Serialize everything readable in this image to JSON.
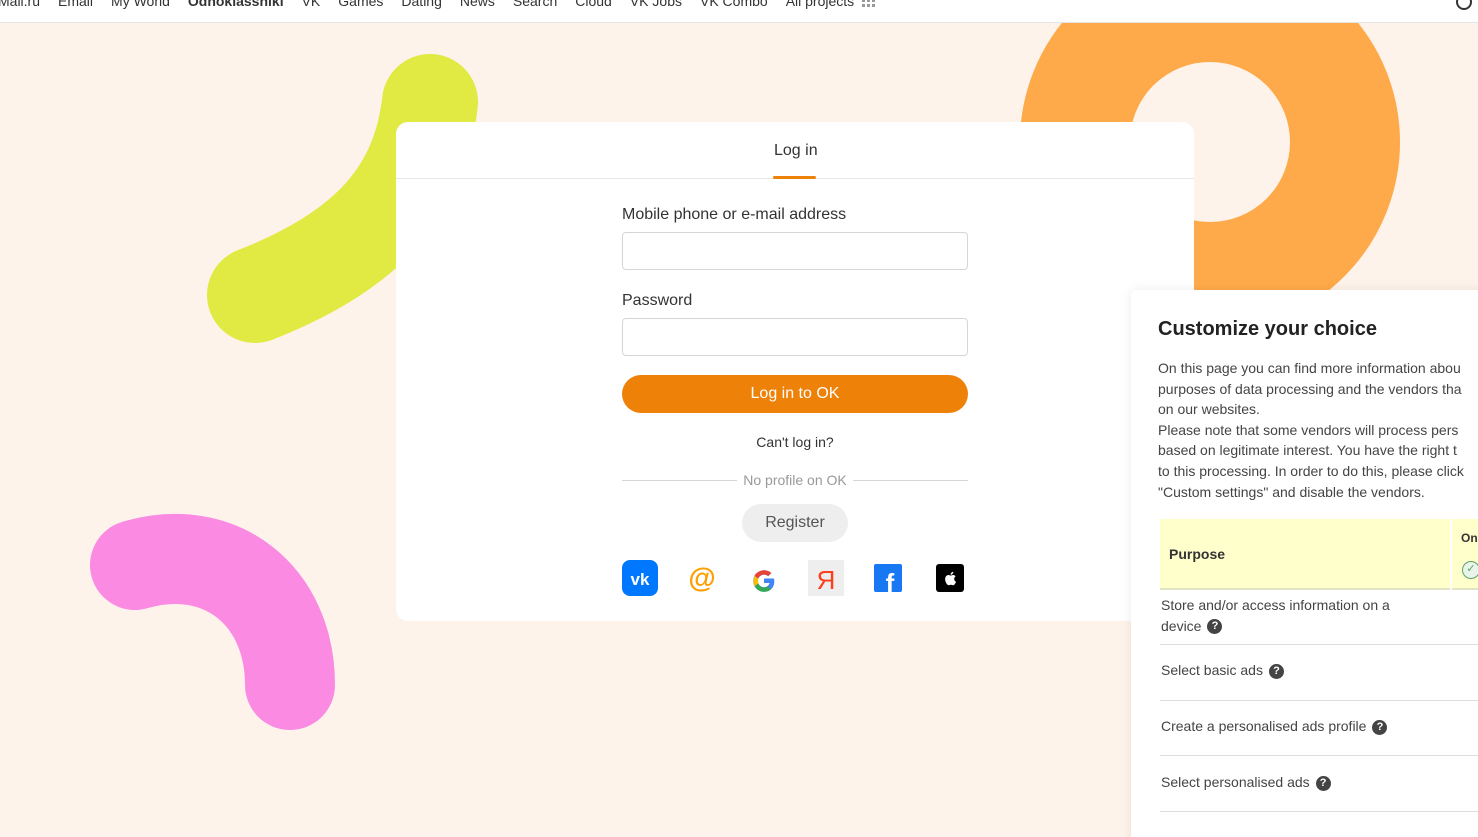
{
  "topnav": {
    "items": [
      "Mail.ru",
      "Email",
      "My World",
      "Odnoklassniki",
      "VK",
      "Games",
      "Dating",
      "News",
      "Search",
      "Cloud",
      "VK Jobs",
      "VK Combo",
      "All projects"
    ],
    "active_index": 3
  },
  "login": {
    "tab_label": "Log in",
    "login_label": "Mobile phone or e-mail address",
    "login_value": "",
    "password_label": "Password",
    "password_value": "",
    "submit_label": "Log in to OK",
    "cant_login": "Can't log in?",
    "divider_text": "No profile on OK",
    "register_label": "Register",
    "social_icons": [
      "vk-icon",
      "mail-ru-icon",
      "google-icon",
      "yandex-icon",
      "facebook-icon",
      "apple-icon"
    ]
  },
  "consent": {
    "title": "Customize your choice",
    "text_lines": [
      "On this page you can find more information abou",
      "purposes of data processing and the vendors tha",
      "on our websites.",
      "Please note that some vendors will process pers",
      "based on legitimate interest. You have the right t",
      "to this processing. In order to do this, please click",
      "\"Custom settings\" and disable the vendors."
    ],
    "table_header_purpose": "Purpose",
    "table_header_on": "On",
    "purposes": [
      "Store and/or access information on a",
      "device",
      "Select basic ads",
      "Create a personalised ads profile",
      "Select personalised ads"
    ]
  },
  "colors": {
    "accent": "#ee8208",
    "background": "#fdf3ea",
    "deco_yellow": "#e1ea42",
    "deco_orange": "#ffaa4a",
    "deco_pink": "#fa8ae2",
    "table_header": "#ffffcc"
  }
}
